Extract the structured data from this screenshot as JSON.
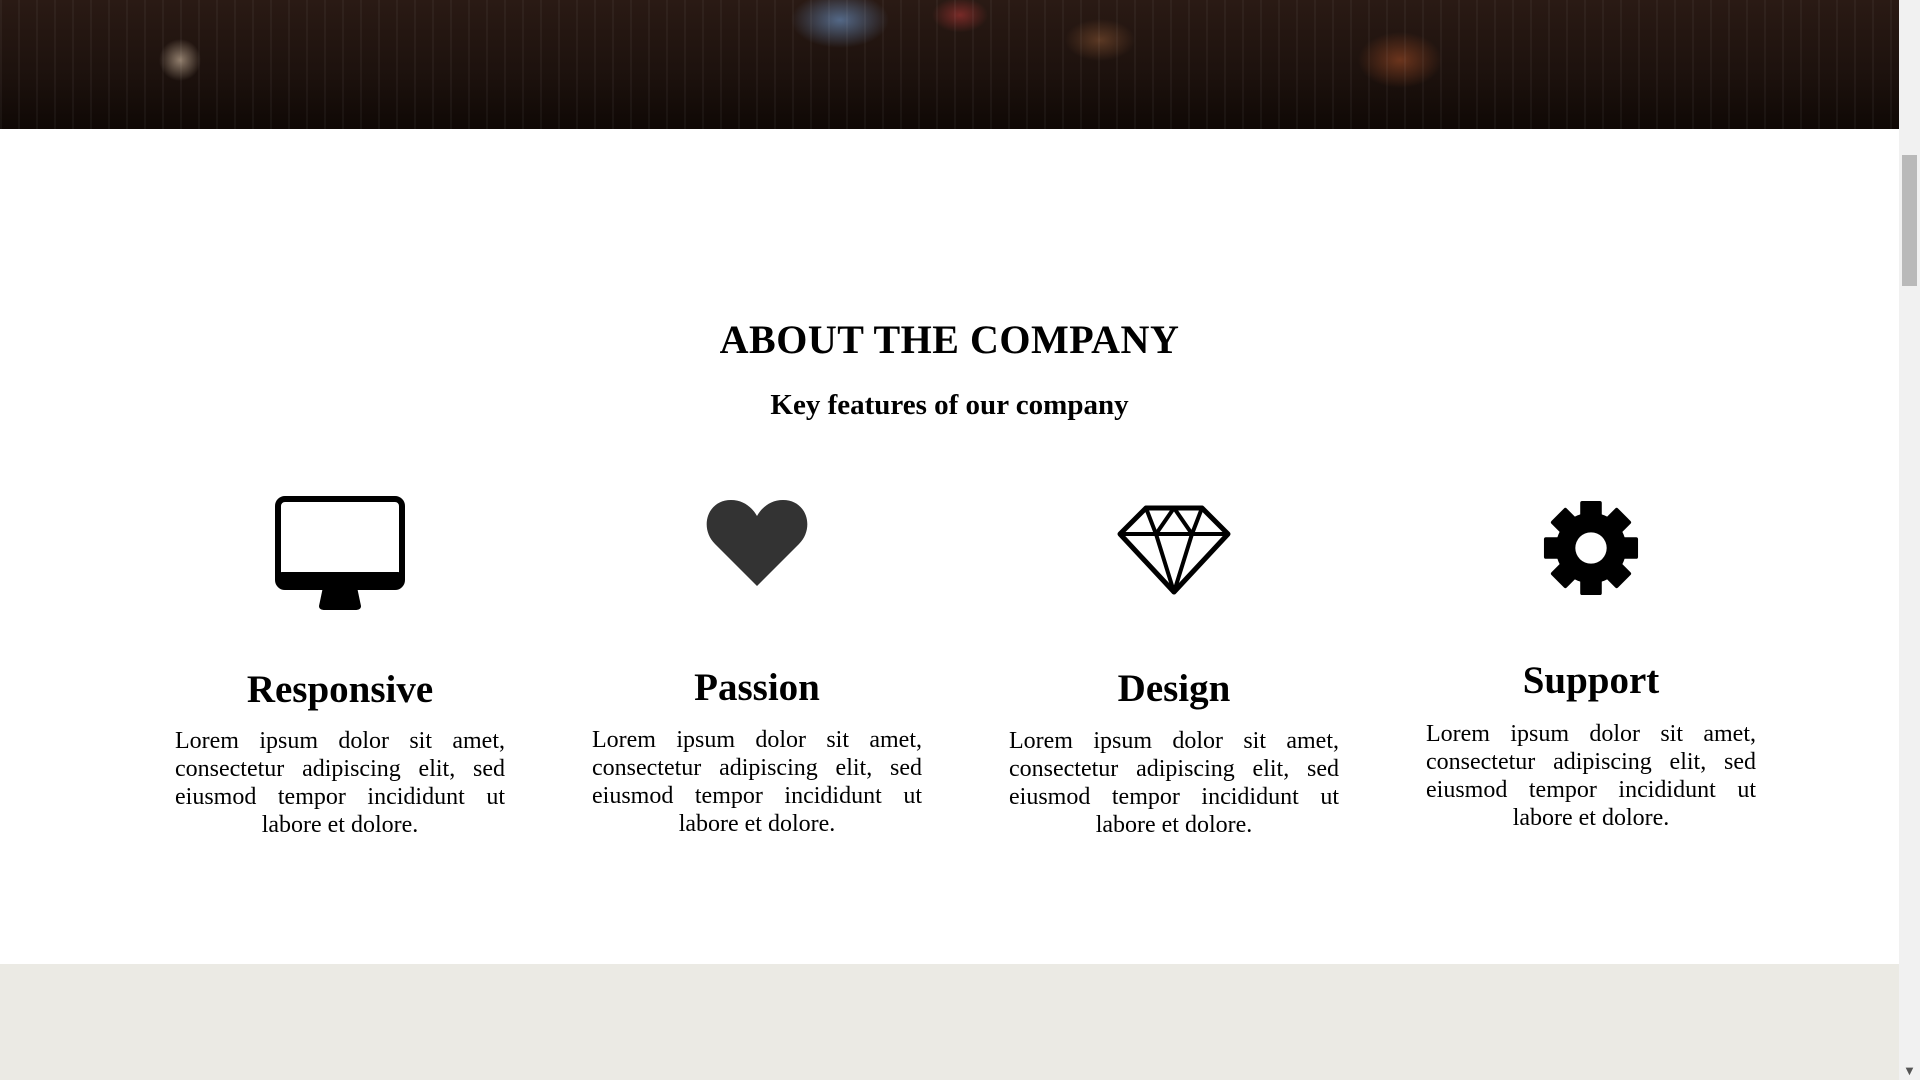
{
  "about": {
    "title": "ABOUT THE COMPANY",
    "subtitle": "Key features of our company"
  },
  "features": [
    {
      "icon": "desktop-monitor-icon",
      "title": "Responsive",
      "text": "Lorem ipsum dolor sit amet, consectetur adipiscing elit, sed eiusmod tempor incididunt ut labore et dolore."
    },
    {
      "icon": "heart-icon",
      "title": "Passion",
      "text": "Lorem ipsum dolor sit amet, consectetur adipiscing elit, sed eiusmod tempor incididunt ut labore et dolore."
    },
    {
      "icon": "diamond-icon",
      "title": "Design",
      "text": "Lorem ipsum dolor sit amet, consectetur adipiscing elit, sed eiusmod tempor incididunt ut labore et dolore."
    },
    {
      "icon": "gear-icon",
      "title": "Support",
      "text": "Lorem ipsum dolor sit amet, consectetur adipiscing elit, sed eiusmod tempor incididunt ut labore et dolore."
    }
  ],
  "colors": {
    "icon": "#000000",
    "heart": "#333333",
    "footer_band": "#ebeae4"
  }
}
